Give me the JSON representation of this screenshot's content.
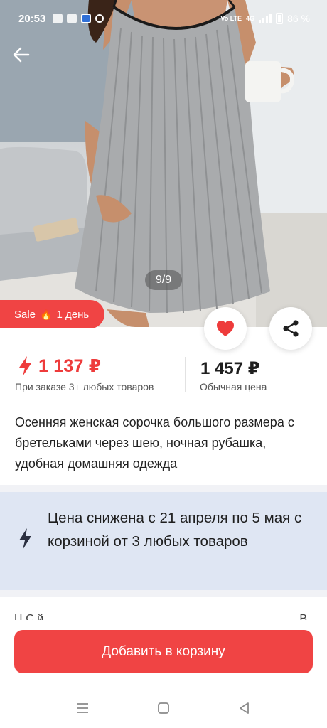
{
  "status_bar": {
    "time": "20:53",
    "network": "Vo LTE",
    "network_type": "4G",
    "battery": "86 %",
    "icons": [
      "gallery-icon",
      "music-icon",
      "shield-icon",
      "search-icon",
      "signal-icon",
      "battery-icon"
    ]
  },
  "gallery": {
    "counter": "9/9"
  },
  "sale_badge": {
    "label": "Sale",
    "duration": "1 день"
  },
  "price": {
    "sale_value": "1 137 ₽",
    "sale_note": "При заказе 3+ любых товаров",
    "regular_value": "1 457 ₽",
    "regular_note": "Обычная цена",
    "sale_color": "#ee3b3b"
  },
  "product": {
    "title": "Осенняя женская сорочка большого размера с бретельками через шею, ночная рубашка, удобная домашняя одежда"
  },
  "promo": {
    "text": "Цена снижена с 21 апреля по 5 мая с корзиной от 3 любых товаров",
    "background": "#dfe6f3"
  },
  "partial_row": {
    "left": "Ц    С     й",
    "right": "В    "
  },
  "actions": {
    "add_to_cart": "Добавить в корзину",
    "accent": "#f04444"
  },
  "nav_bar": {
    "icons": [
      "menu-icon",
      "home-icon",
      "back-triangle-icon"
    ]
  }
}
